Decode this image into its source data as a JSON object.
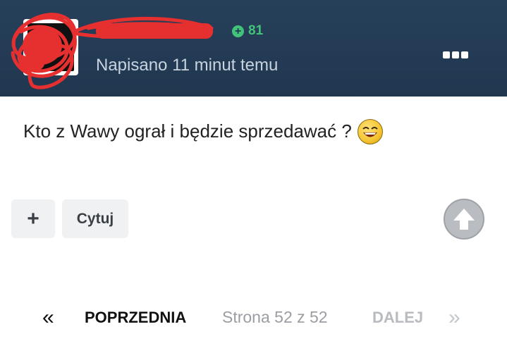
{
  "post": {
    "reputation": "81",
    "timestamp": "Napisano 11 minut temu",
    "content": "Kto z Wawy ograł i będzie sprzedawać ?",
    "emoji": "laughing-emoji"
  },
  "actions": {
    "plus_label": "+",
    "quote_label": "Cytuj"
  },
  "pagination": {
    "prev_arrow": "«",
    "prev_label": "POPRZEDNIA",
    "page_info": "Strona 52 z 52",
    "next_label": "DALEJ",
    "next_arrow": "»"
  },
  "colors": {
    "header_bg": "#203750",
    "reputation": "#43c27a",
    "redaction": "#e63030"
  }
}
